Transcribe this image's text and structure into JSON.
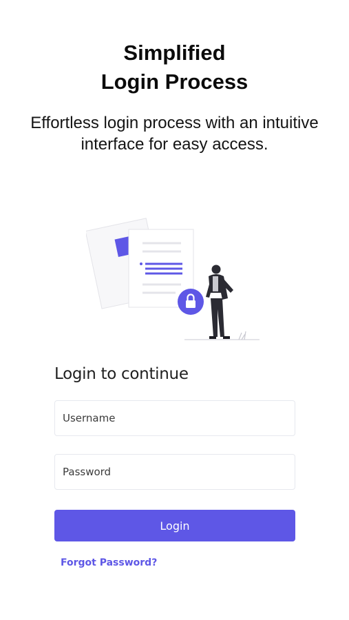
{
  "hero": {
    "title_line1": "Simplified",
    "title_line2": "Login Process",
    "subtitle": "Effortless login process with an intuitive interface for easy access."
  },
  "illustration": {
    "icons": [
      "document-icon",
      "lock-icon",
      "person-icon"
    ]
  },
  "form": {
    "heading": "Login to continue",
    "username_placeholder": "Username",
    "password_placeholder": "Password",
    "login_label": "Login",
    "forgot_label": "Forgot Password?"
  },
  "colors": {
    "accent": "#5e57e6",
    "text": "#111111",
    "field_border": "#e6e8ee"
  }
}
